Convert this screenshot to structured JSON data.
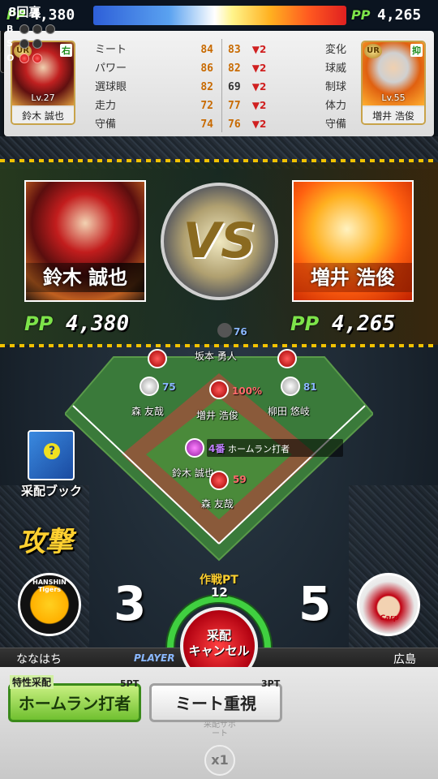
{
  "top": {
    "left_pp_label": "PP",
    "left_pp": "4,380",
    "right_pp_label": "PP",
    "right_pp": "4,265"
  },
  "batter_card": {
    "rarity": "UR",
    "hand": "右",
    "level": "Lv.27",
    "name": "鈴木 誠也"
  },
  "pitcher_card": {
    "rarity": "UR",
    "hand": "抑",
    "level": "Lv.55",
    "name": "増井 浩俊"
  },
  "batter_stats": [
    {
      "label": "ミート",
      "value": "84"
    },
    {
      "label": "パワー",
      "value": "86"
    },
    {
      "label": "選球眼",
      "value": "82"
    },
    {
      "label": "走力",
      "value": "72"
    },
    {
      "label": "守備",
      "value": "74"
    }
  ],
  "pitcher_stats": [
    {
      "label": "変化",
      "value": "83",
      "delta": "▼2"
    },
    {
      "label": "球威",
      "value": "82",
      "delta": "▼2"
    },
    {
      "label": "制球",
      "value": "69",
      "delta": "▼2"
    },
    {
      "label": "体力",
      "value": "77",
      "delta": "▼2"
    },
    {
      "label": "守備",
      "value": "76",
      "delta": "▼2"
    }
  ],
  "versus": {
    "left_name": "鈴木 誠也",
    "right_name": "増井 浩俊",
    "vs_text": "VS",
    "left_pp_label": "PP",
    "left_pp": "4,380",
    "right_pp_label": "PP",
    "right_pp": "4,265"
  },
  "field": {
    "top_value": "76",
    "catcher_name": "坂本 勇人",
    "left_fielder_name": "森 友哉",
    "left_fielder_value": "75",
    "pitcher_name": "増井 浩俊",
    "pitcher_value": "100%",
    "right_fielder_name": "柳田 悠岐",
    "right_fielder_value": "81",
    "batter_order": "4番",
    "batter_tag": "ホームラン打者",
    "batter_name": "鈴木 誠也",
    "catcher2_value": "59",
    "catcher2_name": "森 友哉"
  },
  "inning": {
    "label": "8回裏",
    "b": "B",
    "s": "S",
    "o": "O"
  },
  "strategy_book": "采配ブック",
  "attack_label": "攻撃",
  "score": {
    "home_team_logo": "HANSHIN Tigers",
    "home_score": "3",
    "away_score": "5",
    "away_team_logo": "Carp"
  },
  "tactic": {
    "label": "作戦PT",
    "value": "12"
  },
  "cancel_button": {
    "line1": "采配",
    "line2": "キャンセル"
  },
  "namebar": {
    "left": "ななはち",
    "center": "PLAYER",
    "right": "広島"
  },
  "skills": [
    {
      "tag": "特性采配",
      "cost": "5PT",
      "label": "ホームラン打者"
    },
    {
      "tag": "",
      "cost": "3PT",
      "label": "ミート重視"
    }
  ],
  "support": {
    "label": "采配サポート",
    "multiplier": "x1"
  },
  "colors": {
    "pp_green": "#7de34a",
    "stat_orange": "#c86a00",
    "delta_red": "#d02020",
    "carp_red": "#c00010"
  }
}
